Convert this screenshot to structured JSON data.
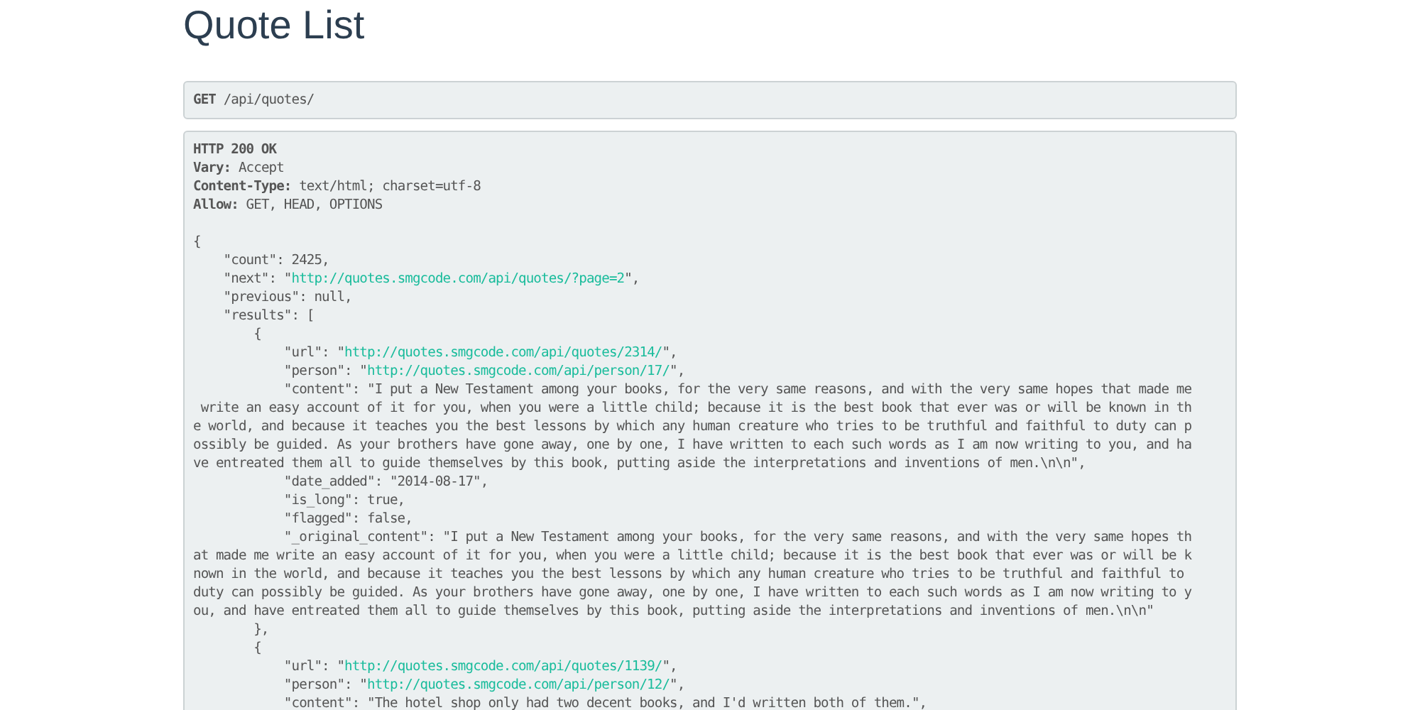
{
  "title": "Quote List",
  "request": {
    "method": "GET",
    "path": "/api/quotes/"
  },
  "response": {
    "status": "HTTP 200 OK",
    "headers": [
      {
        "name": "Vary:",
        "value": "Accept"
      },
      {
        "name": "Content-Type:",
        "value": "text/html; charset=utf-8"
      },
      {
        "name": "Allow:",
        "value": "GET, HEAD, OPTIONS"
      }
    ],
    "body": [
      [
        {
          "kind": "plain",
          "text": "{"
        }
      ],
      [
        {
          "kind": "plain",
          "text": "    \"count\": 2425,"
        }
      ],
      [
        {
          "kind": "plain",
          "text": "    \"next\": \""
        },
        {
          "kind": "link",
          "text": "http://quotes.smgcode.com/api/quotes/?page=2"
        },
        {
          "kind": "plain",
          "text": "\","
        }
      ],
      [
        {
          "kind": "plain",
          "text": "    \"previous\": null,"
        }
      ],
      [
        {
          "kind": "plain",
          "text": "    \"results\": ["
        }
      ],
      [
        {
          "kind": "plain",
          "text": "        {"
        }
      ],
      [
        {
          "kind": "plain",
          "text": "            \"url\": \""
        },
        {
          "kind": "link",
          "text": "http://quotes.smgcode.com/api/quotes/2314/"
        },
        {
          "kind": "plain",
          "text": "\","
        }
      ],
      [
        {
          "kind": "plain",
          "text": "            \"person\": \""
        },
        {
          "kind": "link",
          "text": "http://quotes.smgcode.com/api/person/17/"
        },
        {
          "kind": "plain",
          "text": "\","
        }
      ],
      [
        {
          "kind": "plain",
          "text": "            \"content\": \"I put a New Testament among your books, for the very same reasons, and with the very same hopes that made me"
        }
      ],
      [
        {
          "kind": "plain",
          "text": " write an easy account of it for you, when you were a little child; because it is the best book that ever was or will be known in th"
        }
      ],
      [
        {
          "kind": "plain",
          "text": "e world, and because it teaches you the best lessons by which any human creature who tries to be truthful and faithful to duty can p"
        }
      ],
      [
        {
          "kind": "plain",
          "text": "ossibly be guided. As your brothers have gone away, one by one, I have written to each such words as I am now writing to you, and ha"
        }
      ],
      [
        {
          "kind": "plain",
          "text": "ve entreated them all to guide themselves by this book, putting aside the interpretations and inventions of men.\\n\\n\","
        }
      ],
      [
        {
          "kind": "plain",
          "text": "            \"date_added\": \"2014-08-17\","
        }
      ],
      [
        {
          "kind": "plain",
          "text": "            \"is_long\": true,"
        }
      ],
      [
        {
          "kind": "plain",
          "text": "            \"flagged\": false,"
        }
      ],
      [
        {
          "kind": "plain",
          "text": "            \"_original_content\": \"I put a New Testament among your books, for the very same reasons, and with the very same hopes th"
        }
      ],
      [
        {
          "kind": "plain",
          "text": "at made me write an easy account of it for you, when you were a little child; because it is the best book that ever was or will be k"
        }
      ],
      [
        {
          "kind": "plain",
          "text": "nown in the world, and because it teaches you the best lessons by which any human creature who tries to be truthful and faithful to"
        }
      ],
      [
        {
          "kind": "plain",
          "text": "duty can possibly be guided. As your brothers have gone away, one by one, I have written to each such words as I am now writing to y"
        }
      ],
      [
        {
          "kind": "plain",
          "text": "ou, and have entreated them all to guide themselves by this book, putting aside the interpretations and inventions of men.\\n\\n\""
        }
      ],
      [
        {
          "kind": "plain",
          "text": "        },"
        }
      ],
      [
        {
          "kind": "plain",
          "text": "        {"
        }
      ],
      [
        {
          "kind": "plain",
          "text": "            \"url\": \""
        },
        {
          "kind": "link",
          "text": "http://quotes.smgcode.com/api/quotes/1139/"
        },
        {
          "kind": "plain",
          "text": "\","
        }
      ],
      [
        {
          "kind": "plain",
          "text": "            \"person\": \""
        },
        {
          "kind": "link",
          "text": "http://quotes.smgcode.com/api/person/12/"
        },
        {
          "kind": "plain",
          "text": "\","
        }
      ],
      [
        {
          "kind": "plain",
          "text": "            \"content\": \"The hotel shop only had two decent books, and I'd written both of them.\","
        }
      ]
    ]
  }
}
